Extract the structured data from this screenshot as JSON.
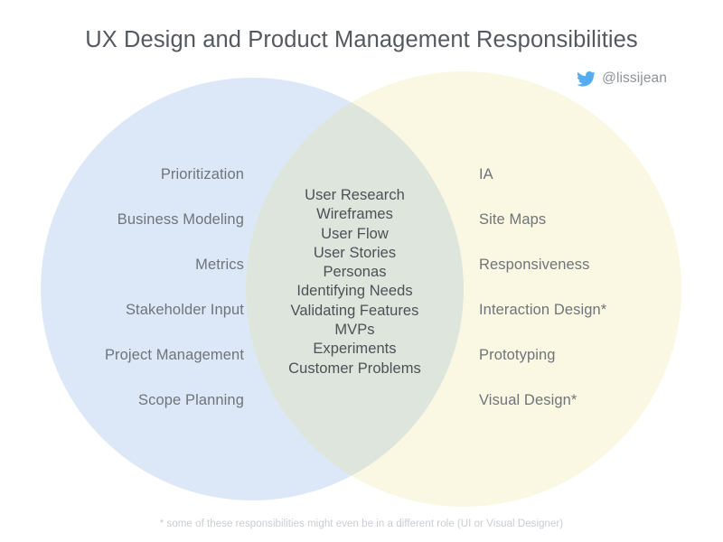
{
  "title": "UX Design and Product Management Responsibilities",
  "social": {
    "icon": "twitter-bird-icon",
    "handle": "@lissijean",
    "icon_color": "#55acee"
  },
  "venn": {
    "left_circle": {
      "name": "product-management-circle",
      "fill": "#dce8f7",
      "items": [
        "Prioritization",
        "Business Modeling",
        "Metrics",
        "Stakeholder Input",
        "Project Management",
        "Scope Planning"
      ]
    },
    "right_circle": {
      "name": "ux-design-circle",
      "fill": "#faf8e3",
      "items": [
        "IA",
        "Site Maps",
        "Responsiveness",
        "Interaction Design*",
        "Prototyping",
        "Visual Design*"
      ]
    },
    "intersection": {
      "name": "shared-responsibilities",
      "fill": "#dde5dd",
      "items": [
        "User Research",
        "Wireframes",
        "User Flow",
        "User Stories",
        "Personas",
        "Identifying Needs",
        "Validating Features",
        "MVPs",
        "Experiments",
        "Customer Problems"
      ]
    }
  },
  "footnote": "* some of these responsibilities might even be in a different role (UI or Visual Designer)"
}
